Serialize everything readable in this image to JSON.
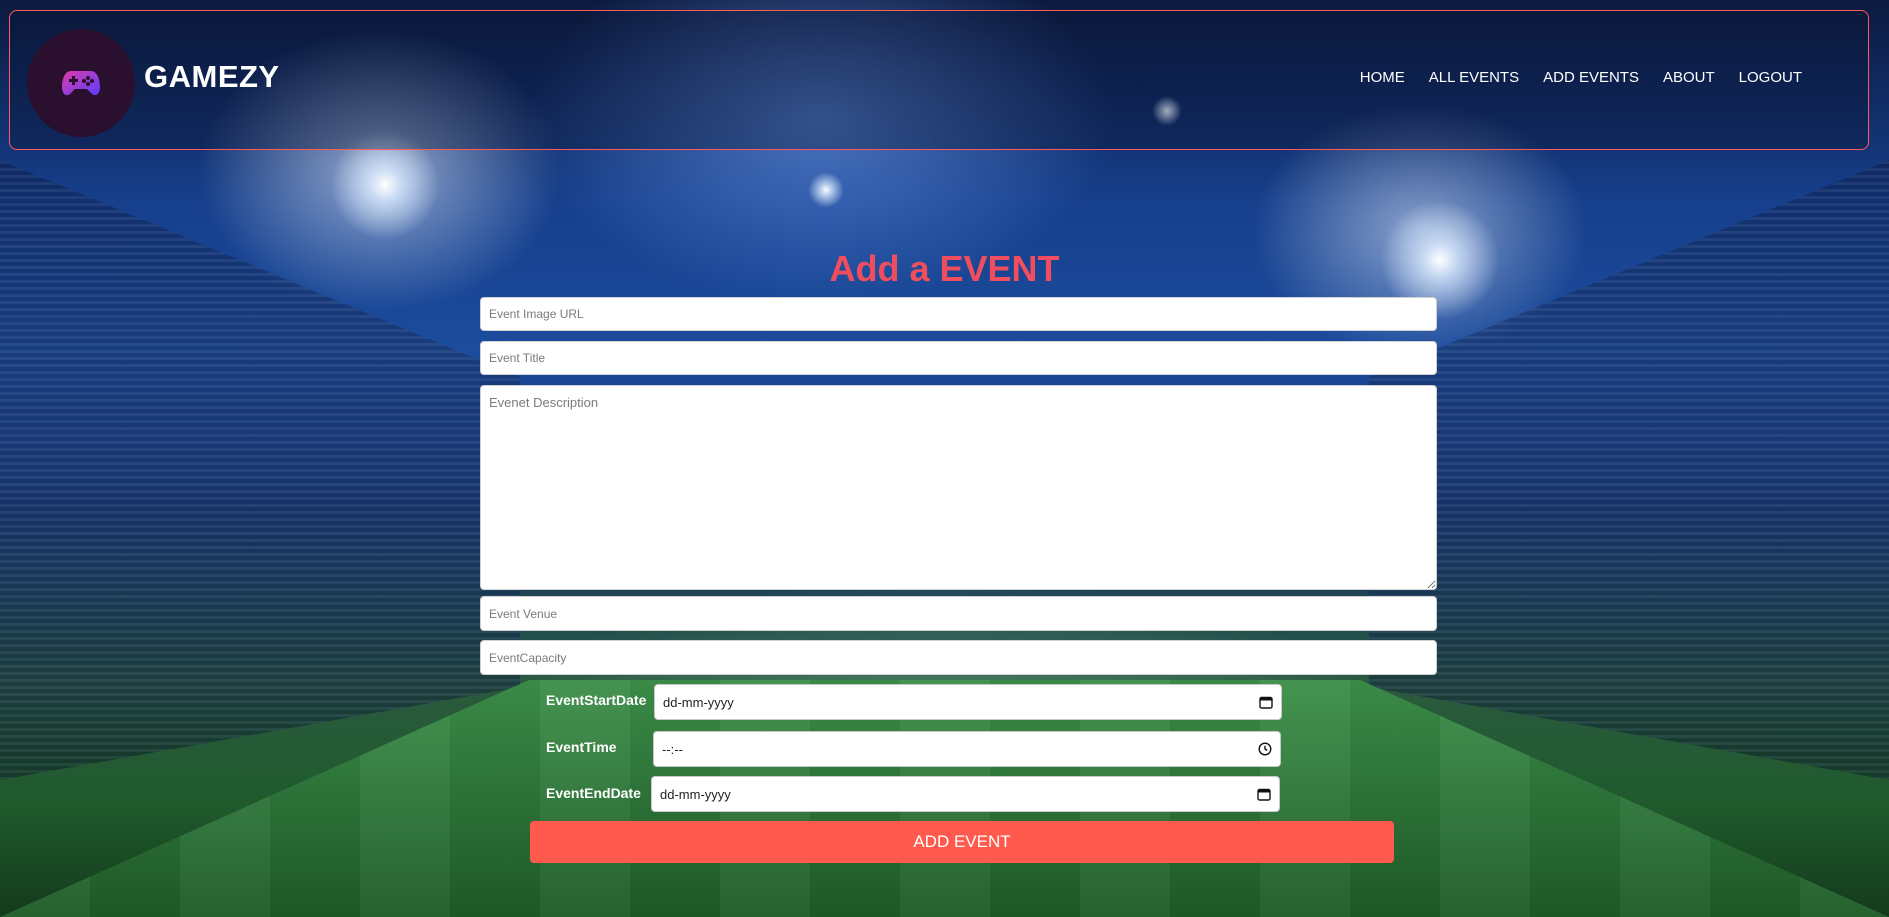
{
  "brand": {
    "name": "GAMEZY",
    "logo_icon": "gamepad-icon",
    "accent": "#ff5a5a"
  },
  "nav": {
    "items": [
      {
        "label": "HOME"
      },
      {
        "label": "ALL EVENTS"
      },
      {
        "label": "ADD EVENTS"
      },
      {
        "label": "ABOUT"
      },
      {
        "label": "LOGOUT"
      }
    ]
  },
  "form": {
    "title": "Add a EVENT",
    "title_color": "#f04e5e",
    "image_url": {
      "placeholder": "Event Image URL",
      "value": ""
    },
    "event_title": {
      "placeholder": "Event Title",
      "value": ""
    },
    "description": {
      "placeholder": "Evenet Description",
      "value": ""
    },
    "venue": {
      "placeholder": "Event Venue",
      "value": ""
    },
    "capacity": {
      "placeholder": "EventCapacity",
      "value": ""
    },
    "start_date": {
      "label": "EventStartDate",
      "value": "dd-mm-yyyy",
      "icon": "calendar-icon"
    },
    "time": {
      "label": "EventTime",
      "value": "--:--",
      "icon": "clock-icon"
    },
    "end_date": {
      "label": "EventEndDate",
      "value": "dd-mm-yyyy",
      "icon": "calendar-icon"
    },
    "submit_label": "ADD EVENT",
    "submit_color": "#ff5a4d"
  }
}
